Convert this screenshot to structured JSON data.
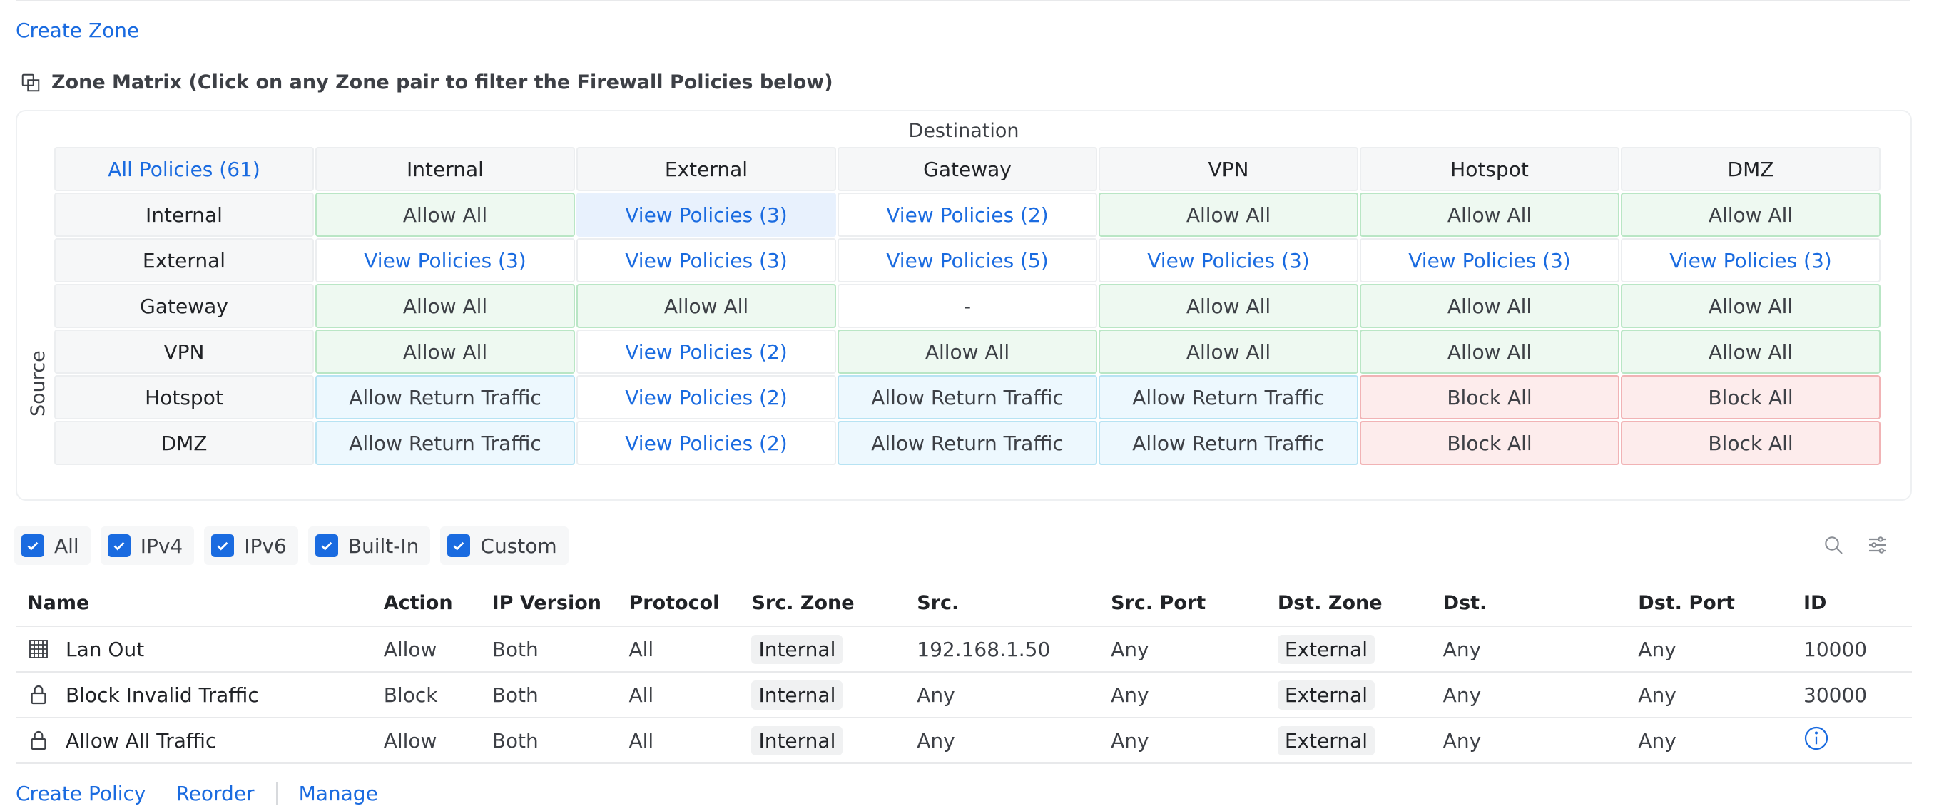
{
  "create_zone_label": "Create Zone",
  "matrix": {
    "title": "Zone Matrix (Click on any Zone pair to filter the Firewall Policies below)",
    "destination_label": "Destination",
    "source_label": "Source",
    "all_policies_label": "All Policies (61)",
    "zones": [
      "Internal",
      "External",
      "Gateway",
      "VPN",
      "Hotspot",
      "DMZ"
    ],
    "rows": [
      {
        "source": "Internal",
        "cells": [
          {
            "text": "Allow All",
            "kind": "allow"
          },
          {
            "text": "View Policies (3)",
            "kind": "view",
            "selected": true
          },
          {
            "text": "View Policies (2)",
            "kind": "view"
          },
          {
            "text": "Allow All",
            "kind": "allow"
          },
          {
            "text": "Allow All",
            "kind": "allow"
          },
          {
            "text": "Allow All",
            "kind": "allow"
          }
        ]
      },
      {
        "source": "External",
        "cells": [
          {
            "text": "View Policies (3)",
            "kind": "view"
          },
          {
            "text": "View Policies (3)",
            "kind": "view"
          },
          {
            "text": "View Policies (5)",
            "kind": "view"
          },
          {
            "text": "View Policies (3)",
            "kind": "view"
          },
          {
            "text": "View Policies (3)",
            "kind": "view"
          },
          {
            "text": "View Policies (3)",
            "kind": "view"
          }
        ]
      },
      {
        "source": "Gateway",
        "cells": [
          {
            "text": "Allow All",
            "kind": "allow"
          },
          {
            "text": "Allow All",
            "kind": "allow"
          },
          {
            "text": "-",
            "kind": "dash"
          },
          {
            "text": "Allow All",
            "kind": "allow"
          },
          {
            "text": "Allow All",
            "kind": "allow"
          },
          {
            "text": "Allow All",
            "kind": "allow"
          }
        ]
      },
      {
        "source": "VPN",
        "cells": [
          {
            "text": "Allow All",
            "kind": "allow"
          },
          {
            "text": "View Policies (2)",
            "kind": "view"
          },
          {
            "text": "Allow All",
            "kind": "allow"
          },
          {
            "text": "Allow All",
            "kind": "allow"
          },
          {
            "text": "Allow All",
            "kind": "allow"
          },
          {
            "text": "Allow All",
            "kind": "allow"
          }
        ]
      },
      {
        "source": "Hotspot",
        "cells": [
          {
            "text": "Allow Return Traffic",
            "kind": "ret"
          },
          {
            "text": "View Policies (2)",
            "kind": "view"
          },
          {
            "text": "Allow Return Traffic",
            "kind": "ret"
          },
          {
            "text": "Allow Return Traffic",
            "kind": "ret"
          },
          {
            "text": "Block All",
            "kind": "block"
          },
          {
            "text": "Block All",
            "kind": "block"
          }
        ]
      },
      {
        "source": "DMZ",
        "cells": [
          {
            "text": "Allow Return Traffic",
            "kind": "ret"
          },
          {
            "text": "View Policies (2)",
            "kind": "view"
          },
          {
            "text": "Allow Return Traffic",
            "kind": "ret"
          },
          {
            "text": "Allow Return Traffic",
            "kind": "ret"
          },
          {
            "text": "Block All",
            "kind": "block"
          },
          {
            "text": "Block All",
            "kind": "block"
          }
        ]
      }
    ]
  },
  "filters": [
    {
      "label": "All",
      "checked": true
    },
    {
      "label": "IPv4",
      "checked": true
    },
    {
      "label": "IPv6",
      "checked": true
    },
    {
      "label": "Built-In",
      "checked": true
    },
    {
      "label": "Custom",
      "checked": true
    }
  ],
  "toolbar_icons": [
    "search-icon",
    "settings-sliders-icon"
  ],
  "policies": {
    "columns": [
      "Name",
      "Action",
      "IP Version",
      "Protocol",
      "Src. Zone",
      "Src.",
      "Src. Port",
      "Dst. Zone",
      "Dst.",
      "Dst. Port",
      "ID"
    ],
    "rows": [
      {
        "icon": "grid-icon",
        "name": "Lan Out",
        "action": "Allow",
        "ip_version": "Both",
        "protocol": "All",
        "src_zone": "Internal",
        "src": "192.168.1.50",
        "src_port": "Any",
        "dst_zone": "External",
        "dst": "Any",
        "dst_port": "Any",
        "id": "10000"
      },
      {
        "icon": "lock-icon",
        "name": "Block Invalid Traffic",
        "action": "Block",
        "ip_version": "Both",
        "protocol": "All",
        "src_zone": "Internal",
        "src": "Any",
        "src_port": "Any",
        "dst_zone": "External",
        "dst": "Any",
        "dst_port": "Any",
        "id": "30000"
      },
      {
        "icon": "lock-icon",
        "name": "Allow All Traffic",
        "action": "Allow",
        "ip_version": "Both",
        "protocol": "All",
        "src_zone": "Internal",
        "src": "Any",
        "src_port": "Any",
        "dst_zone": "External",
        "dst": "Any",
        "dst_port": "Any",
        "id": "",
        "id_icon": "info-icon"
      }
    ]
  },
  "footer": {
    "create_policy": "Create Policy",
    "reorder": "Reorder",
    "manage": "Manage"
  },
  "colors": {
    "accent": "#1a6be0",
    "allow_bg": "#eef9f1",
    "return_bg": "#edf8fe",
    "block_bg": "#fdecec"
  }
}
